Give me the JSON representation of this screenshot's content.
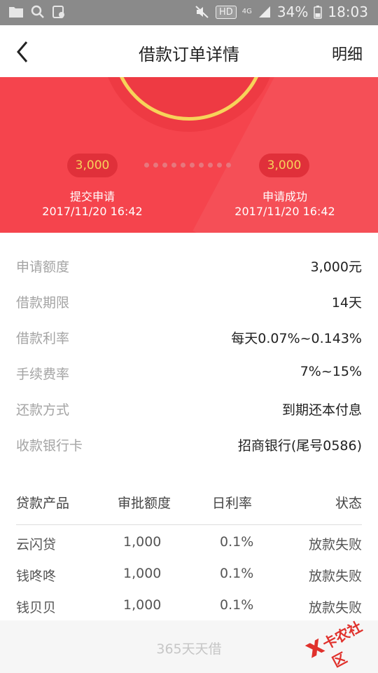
{
  "status_bar": {
    "hd": "HD",
    "network": "4G",
    "battery": "34%",
    "time": "18:03"
  },
  "header": {
    "title": "借款订单详情",
    "right_link": "明细"
  },
  "banner": {
    "left_amount": "3,000",
    "right_amount": "3,000",
    "left_step": "提交申请",
    "left_time": "2017/11/20 16:42",
    "right_step": "申请成功",
    "right_time": "2017/11/20 16:42"
  },
  "info": [
    {
      "label": "申请额度",
      "value": "3,000元"
    },
    {
      "label": "借款期限",
      "value": "14天"
    },
    {
      "label": "借款利率",
      "value": "每天0.07%~0.143%"
    },
    {
      "label": "手续费率",
      "value": "7%~15%"
    },
    {
      "label": "还款方式",
      "value": "到期还本付息"
    },
    {
      "label": "收款银行卡",
      "value": "招商银行(尾号0586)"
    }
  ],
  "table": {
    "headers": [
      "贷款产品",
      "审批额度",
      "日利率",
      "状态"
    ],
    "rows": [
      [
        "云闪贷",
        "1,000",
        "0.1%",
        "放款失败"
      ],
      [
        "钱咚咚",
        "1,000",
        "0.1%",
        "放款失败"
      ],
      [
        "钱贝贝",
        "1,000",
        "0.1%",
        "放款失败"
      ]
    ]
  },
  "footer": {
    "text": "365天天借"
  },
  "watermark": {
    "text": "卡农社区"
  },
  "colors": {
    "banner_red": "#f5444d",
    "gold": "#f7d35a"
  }
}
